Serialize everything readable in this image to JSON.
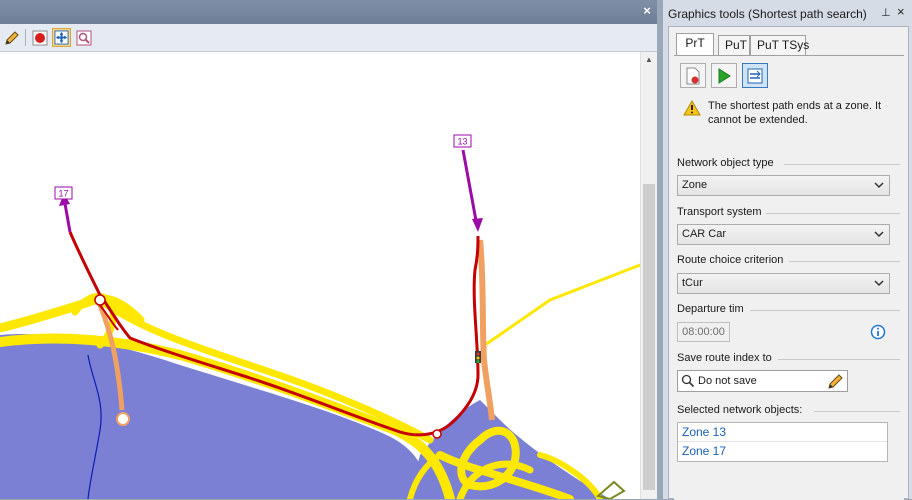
{
  "map": {
    "close_glyph": "×",
    "toolbar_icons": [
      "pencil-icon",
      "record-icon",
      "pan-icon",
      "zoom-icon"
    ],
    "scroll_up_glyph": "▲",
    "zone_labels": {
      "a": "17",
      "b": "13"
    }
  },
  "panel": {
    "title": "Graphics tools (Shortest path search)",
    "pin_glyph": "⊥",
    "close_glyph": "×",
    "tabs": [
      "PrT",
      "PuT",
      "PuT TSys"
    ],
    "active_tab": "PrT",
    "warning": "The shortest path ends at a zone. It cannot be extended.",
    "network_object_type": {
      "label": "Network object type",
      "value": "Zone"
    },
    "transport_system": {
      "label": "Transport system",
      "value": "CAR Car"
    },
    "route_choice": {
      "label": "Route choice criterion",
      "value": "tCur"
    },
    "departure": {
      "label": "Departure tim",
      "value": "08:00:00"
    },
    "save_route": {
      "label": "Save route index to",
      "value": "Do not save"
    },
    "selected": {
      "label": "Selected network objects:",
      "items": [
        "Zone 13",
        "Zone 17"
      ]
    }
  },
  "colors": {
    "zone_fill": "#7b80d4",
    "road_yellow": "#ffe800",
    "path_red": "#c40000",
    "connector_orange": "#f0a060",
    "arrow_purple": "#9c0aa8",
    "link_blue": "#1a5fb4"
  }
}
